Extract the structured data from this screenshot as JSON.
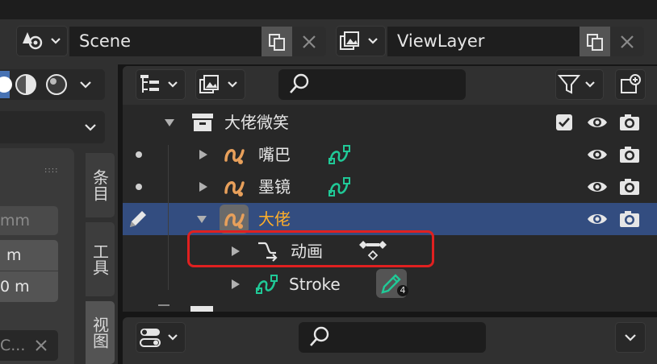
{
  "header": {
    "scene": {
      "label": "Scene",
      "icon": "scene-icon"
    },
    "view_layer": {
      "label": "ViewLayer",
      "icon": "render-layers-icon"
    }
  },
  "left_panel": {
    "field_mm": "mm",
    "field_m1": "m",
    "field_m2": "0 m",
    "field_bottom": "C..."
  },
  "side_tabs": [
    "条目",
    "工具",
    "视图"
  ],
  "outliner": {
    "rows": [
      {
        "label": "大佬微笑",
        "type": "collection"
      },
      {
        "label": "嘴巴",
        "type": "grease-pencil-object"
      },
      {
        "label": "墨镜",
        "type": "grease-pencil-object"
      },
      {
        "label": "大佬",
        "type": "grease-pencil-object",
        "active": true
      },
      {
        "label": "动画",
        "type": "animation-data"
      },
      {
        "label": "Stroke",
        "type": "grease-pencil-data",
        "badge": "4"
      }
    ]
  },
  "colors": {
    "highlight_row": "#334d80",
    "active_text": "#ffaf29",
    "object_icon": "#e8a05b",
    "data_icon": "#20c997",
    "annotation": "#e02020"
  }
}
